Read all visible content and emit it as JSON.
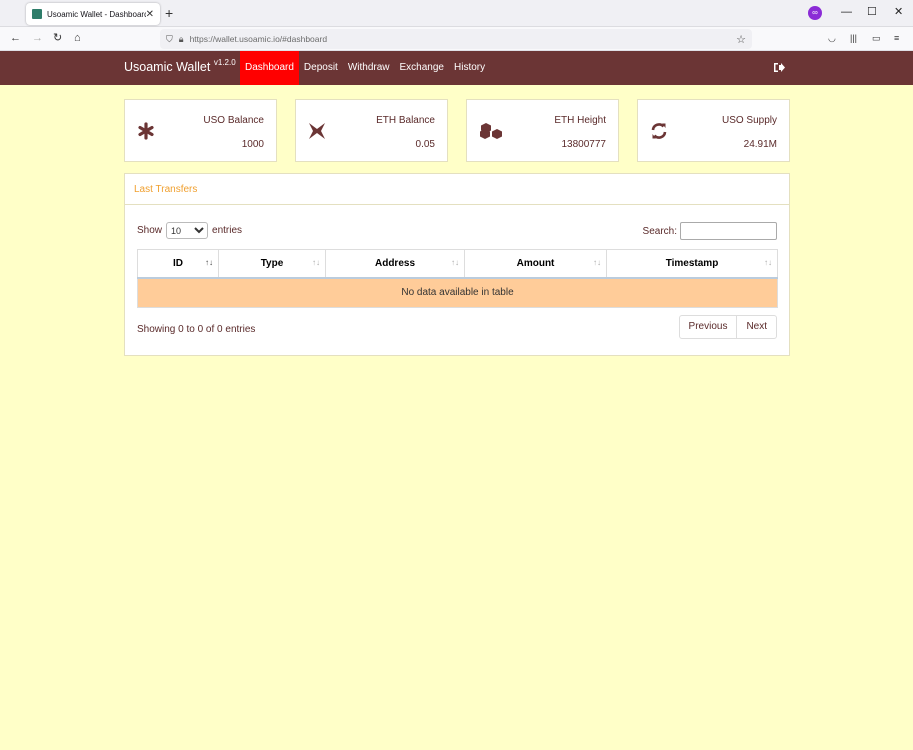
{
  "browser": {
    "tab_title": "Usoamic Wallet - Dashboard",
    "url": "https://wallet.usoamic.io/#dashboard"
  },
  "app": {
    "brand": "Usoamic Wallet",
    "version": "v1.2.0",
    "menu": [
      {
        "label": "Dashboard",
        "active": true
      },
      {
        "label": "Deposit",
        "active": false
      },
      {
        "label": "Withdraw",
        "active": false
      },
      {
        "label": "Exchange",
        "active": false
      },
      {
        "label": "History",
        "active": false
      }
    ]
  },
  "cards": [
    {
      "icon": "asterisk-icon",
      "label": "USO Balance",
      "value": "1000"
    },
    {
      "icon": "ethereum-icon",
      "label": "ETH Balance",
      "value": "0.05"
    },
    {
      "icon": "cubes-icon",
      "label": "ETH Height",
      "value": "13800777"
    },
    {
      "icon": "refresh-icon",
      "label": "USO Supply",
      "value": "24.91M"
    }
  ],
  "transfers": {
    "title": "Last Transfers",
    "show_label": "Show",
    "entries_label": "entries",
    "page_size": "10",
    "search_label": "Search:",
    "columns": [
      "ID",
      "Type",
      "Address",
      "Amount",
      "Timestamp"
    ],
    "empty_text": "No data available in table",
    "info": "Showing 0 to 0 of 0 entries",
    "prev_label": "Previous",
    "next_label": "Next"
  }
}
